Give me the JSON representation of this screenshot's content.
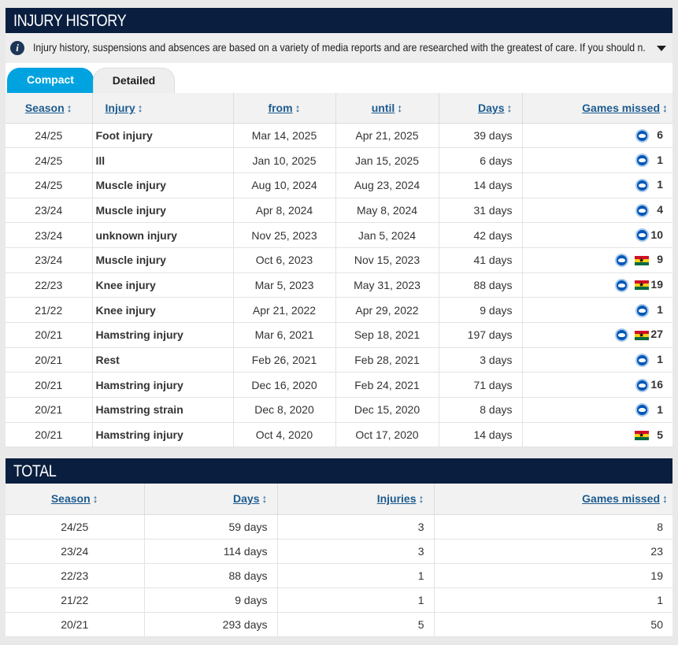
{
  "injury_history": {
    "title": "INJURY HISTORY",
    "note": "Injury history, suspensions and absences are based on a variety of media reports and are researched with the greatest of care. If you should n...",
    "tabs": {
      "compact": "Compact",
      "detailed": "Detailed"
    },
    "columns": {
      "season": "Season",
      "injury": "Injury",
      "from": "from",
      "until": "until",
      "days": "Days",
      "games_missed": "Games missed"
    },
    "rows": [
      {
        "season": "24/25",
        "injury": "Foot injury",
        "from": "Mar 14, 2025",
        "until": "Apr 21, 2025",
        "days": "39 days",
        "games": "6",
        "club": true,
        "nation": false
      },
      {
        "season": "24/25",
        "injury": "Ill",
        "from": "Jan 10, 2025",
        "until": "Jan 15, 2025",
        "days": "6 days",
        "games": "1",
        "club": true,
        "nation": false
      },
      {
        "season": "24/25",
        "injury": "Muscle injury",
        "from": "Aug 10, 2024",
        "until": "Aug 23, 2024",
        "days": "14 days",
        "games": "1",
        "club": true,
        "nation": false
      },
      {
        "season": "23/24",
        "injury": "Muscle injury",
        "from": "Apr 8, 2024",
        "until": "May 8, 2024",
        "days": "31 days",
        "games": "4",
        "club": true,
        "nation": false
      },
      {
        "season": "23/24",
        "injury": "unknown injury",
        "from": "Nov 25, 2023",
        "until": "Jan 5, 2024",
        "days": "42 days",
        "games": "10",
        "club": true,
        "nation": false
      },
      {
        "season": "23/24",
        "injury": "Muscle injury",
        "from": "Oct 6, 2023",
        "until": "Nov 15, 2023",
        "days": "41 days",
        "games": "9",
        "club": true,
        "nation": true
      },
      {
        "season": "22/23",
        "injury": "Knee injury",
        "from": "Mar 5, 2023",
        "until": "May 31, 2023",
        "days": "88 days",
        "games": "19",
        "club": true,
        "nation": true
      },
      {
        "season": "21/22",
        "injury": "Knee injury",
        "from": "Apr 21, 2022",
        "until": "Apr 29, 2022",
        "days": "9 days",
        "games": "1",
        "club": true,
        "nation": false
      },
      {
        "season": "20/21",
        "injury": "Hamstring injury",
        "from": "Mar 6, 2021",
        "until": "Sep 18, 2021",
        "days": "197 days",
        "games": "27",
        "club": true,
        "nation": true
      },
      {
        "season": "20/21",
        "injury": "Rest",
        "from": "Feb 26, 2021",
        "until": "Feb 28, 2021",
        "days": "3 days",
        "games": "1",
        "club": true,
        "nation": false
      },
      {
        "season": "20/21",
        "injury": "Hamstring injury",
        "from": "Dec 16, 2020",
        "until": "Feb 24, 2021",
        "days": "71 days",
        "games": "16",
        "club": true,
        "nation": false
      },
      {
        "season": "20/21",
        "injury": "Hamstring strain",
        "from": "Dec 8, 2020",
        "until": "Dec 15, 2020",
        "days": "8 days",
        "games": "1",
        "club": true,
        "nation": false
      },
      {
        "season": "20/21",
        "injury": "Hamstring injury",
        "from": "Oct 4, 2020",
        "until": "Oct 17, 2020",
        "days": "14 days",
        "games": "5",
        "club": false,
        "nation": true
      }
    ]
  },
  "total": {
    "title": "TOTAL",
    "columns": {
      "season": "Season",
      "days": "Days",
      "injuries": "Injuries",
      "games_missed": "Games missed"
    },
    "rows": [
      {
        "season": "24/25",
        "days": "59 days",
        "injuries": "3",
        "games": "8"
      },
      {
        "season": "23/24",
        "days": "114 days",
        "injuries": "3",
        "games": "23"
      },
      {
        "season": "22/23",
        "days": "88 days",
        "injuries": "1",
        "games": "19"
      },
      {
        "season": "21/22",
        "days": "9 days",
        "injuries": "1",
        "games": "1"
      },
      {
        "season": "20/21",
        "days": "293 days",
        "injuries": "5",
        "games": "50"
      }
    ]
  },
  "sort_glyph": "↕",
  "icons": {
    "club": "club-crest-icon",
    "nation": "ghana-flag-icon",
    "info": "info-icon",
    "expand": "chevron-down-icon"
  }
}
